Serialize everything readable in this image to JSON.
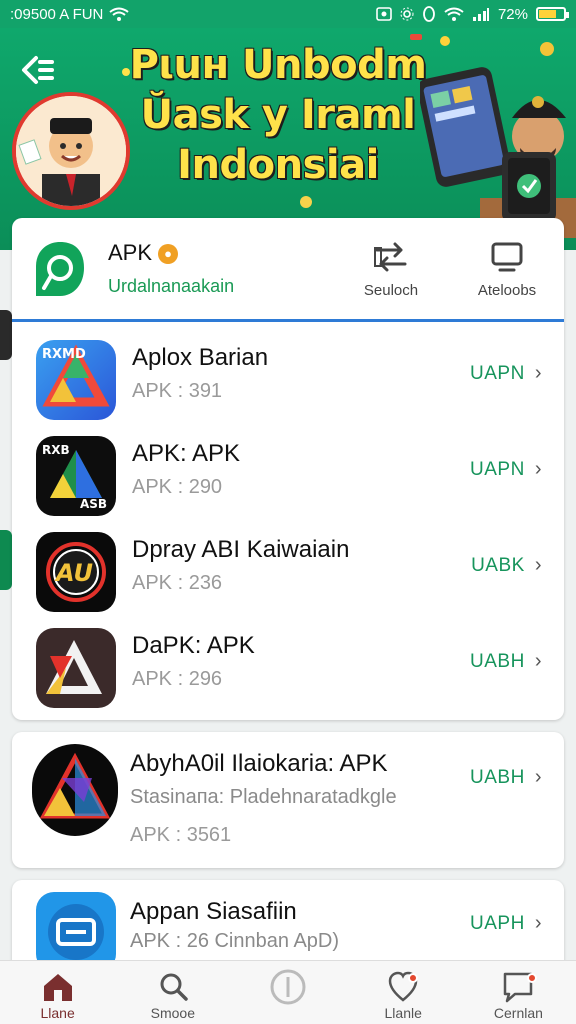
{
  "status_bar": {
    "left_text": ":09500 A FUN",
    "right_text": "72%",
    "battery_level": 0.72
  },
  "banner": {
    "title_lines": [
      "Pιuн Unbodm",
      "Ŭask y Iraml",
      "Indonsiai"
    ],
    "back_icon": "back-arrow-icon"
  },
  "store": {
    "name": "APK",
    "subtitle": "Urdalnanaakain",
    "actions": [
      {
        "label": "Seuloch",
        "icon": "swap-arrows-icon"
      },
      {
        "label": "Ateloobs",
        "icon": "tablet-icon"
      }
    ]
  },
  "apps": [
    {
      "name": "Aplox Barian",
      "meta": "APK : 391",
      "action": "UAPN",
      "icon_text": "RXMD"
    },
    {
      "name": "APK: APK",
      "meta": "APK : 290",
      "action": "UAPN",
      "icon_text": "ASB"
    },
    {
      "name": "Dpray ABI Kaiwaiain",
      "meta": "APK : 236",
      "action": "UABK",
      "icon_text": "AU"
    },
    {
      "name": "DaPK: APK",
      "meta": "APK : 296",
      "action": "UABH",
      "icon_text": ""
    }
  ],
  "featured_app": {
    "name": "AbyhA0il Ilaiokaria: APK",
    "description": "Stasinaпа: Pladehnaratadkgle",
    "meta": "APK : 3561",
    "action": "UABH"
  },
  "last_app": {
    "name": "Appan Siasafiin",
    "meta": "APK : 26 Cinnban ApD)",
    "action": "UAPH"
  },
  "bottom_nav": [
    {
      "label": "Llane",
      "icon": "home-icon",
      "active": true,
      "badge": false
    },
    {
      "label": "Smooe",
      "icon": "search-icon",
      "active": false,
      "badge": false
    },
    {
      "label": "",
      "icon": "compass-icon",
      "active": false,
      "badge": false
    },
    {
      "label": "Llanle",
      "icon": "heart-location-icon",
      "active": false,
      "badge": true
    },
    {
      "label": "Cernlan",
      "icon": "chat-icon",
      "active": false,
      "badge": true
    }
  ],
  "colors": {
    "brand_green": "#12a36a",
    "action_green": "#17945c",
    "divider_blue": "#2e7bd6",
    "title_yellow": "#ffe24a",
    "active_nav": "#7a2f2f"
  }
}
